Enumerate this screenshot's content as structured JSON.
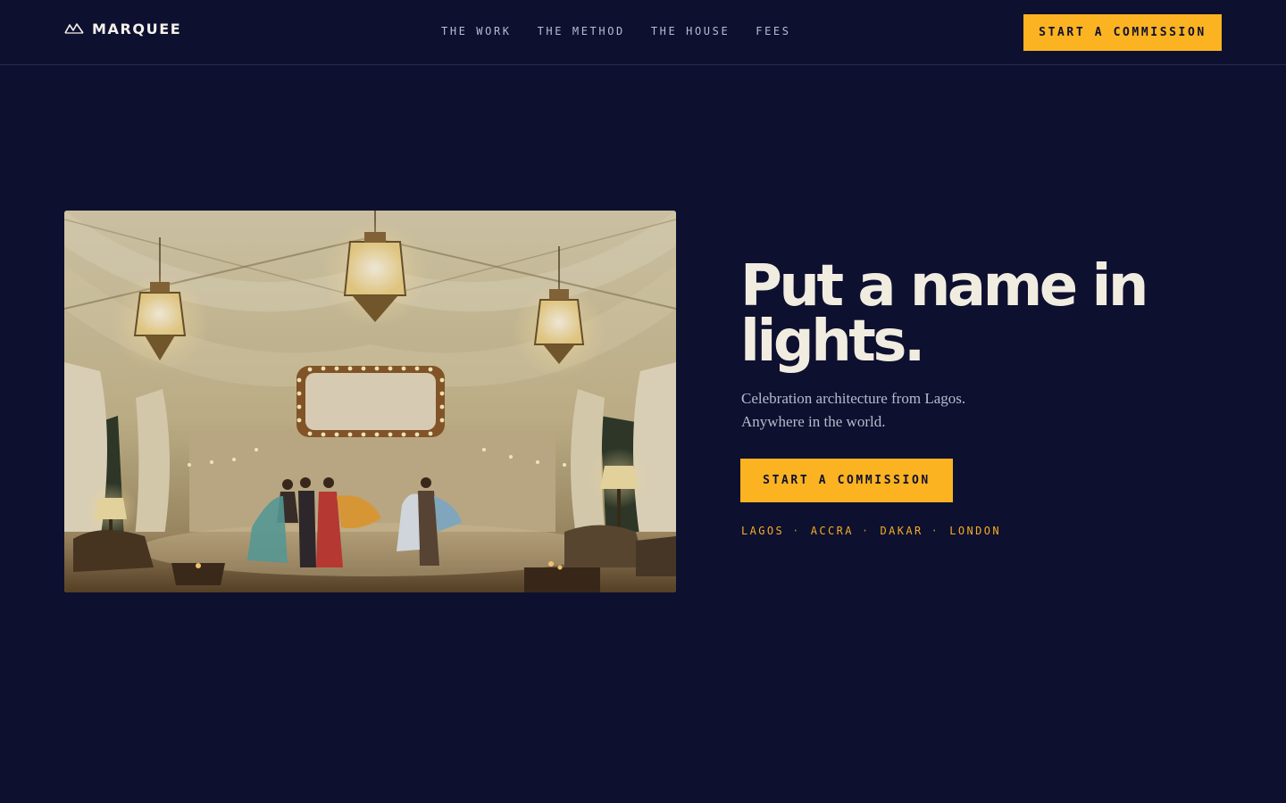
{
  "brand": {
    "name": "MARQUEE",
    "logo_icon": "mountain-peaks-icon"
  },
  "nav": {
    "items": [
      {
        "label": "THE WORK"
      },
      {
        "label": "THE METHOD"
      },
      {
        "label": "THE HOUSE"
      },
      {
        "label": "FEES"
      }
    ]
  },
  "header": {
    "cta_label": "START A COMMISSION"
  },
  "hero": {
    "title": "Put a name in lights.",
    "subtitle_line1": "Celebration architecture from Lagos.",
    "subtitle_line2": "Anywhere in the world.",
    "cta_label": "START A COMMISSION",
    "cities": [
      "LAGOS",
      "ACCRA",
      "DAKAR",
      "LONDON"
    ],
    "city_separator": "·"
  },
  "colors": {
    "background": "#0e1030",
    "accent": "#fbb321",
    "headline": "#f1ece0",
    "muted_text": "#b8bacb",
    "city_text": "#f2ad25"
  }
}
